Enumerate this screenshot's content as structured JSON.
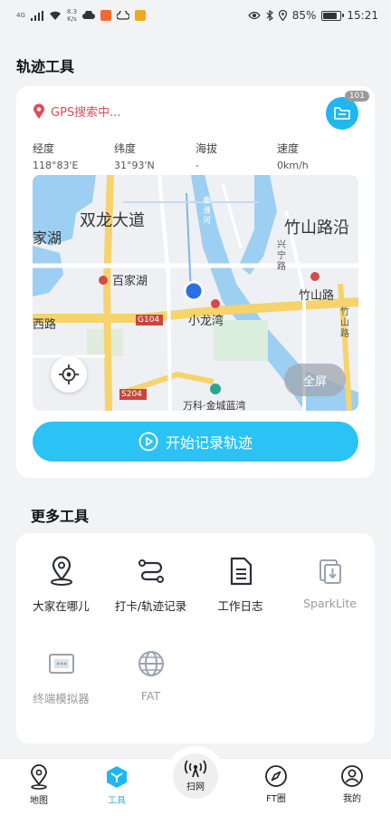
{
  "status_bar": {
    "network_type": "4G",
    "net_speed_value": "8.3",
    "net_speed_unit": "K/s",
    "battery_percent": "85%",
    "battery_level": 0.85,
    "time": "15:21"
  },
  "track_section": {
    "title": "轨迹工具",
    "gps_status": "GPS搜索中...",
    "folder_count": "101",
    "metrics": [
      {
        "label": "经度",
        "value": "118°83'E"
      },
      {
        "label": "纬度",
        "value": "31°93'N"
      },
      {
        "label": "海拔",
        "value": "-"
      },
      {
        "label": "速度",
        "value": "0km/h"
      }
    ],
    "map_labels": {
      "shuanglong": "双龙大道",
      "zhushan_yan": "竹山路沿",
      "baijiahu": "百家湖",
      "zhushan_lu": "竹山路",
      "xiaolongwan": "小龙湾",
      "xilu": "西路",
      "lake": "家湖",
      "xingning": "兴宁路",
      "zhushan_v": "竹山路",
      "qinhuai": "秦淮河",
      "g104": "G104",
      "s204": "S204",
      "bottom_poi": "万科·金城蓝湾"
    },
    "fullscreen_label": "全屏",
    "start_button_label": "开始记录轨迹"
  },
  "more_tools": {
    "title": "更多工具",
    "items": [
      {
        "label": "大家在哪儿",
        "icon": "location-pin-icon",
        "enabled": true
      },
      {
        "label": "打卡/轨迹记录",
        "icon": "route-icon",
        "enabled": true
      },
      {
        "label": "工作日志",
        "icon": "document-icon",
        "enabled": true
      },
      {
        "label": "SparkLite",
        "icon": "spark-download-icon",
        "enabled": false
      },
      {
        "label": "终端模拟器",
        "icon": "terminal-simulator-icon",
        "enabled": false
      },
      {
        "label": "FAT",
        "icon": "globe-icon",
        "enabled": false
      }
    ]
  },
  "tab_bar": {
    "tabs": [
      {
        "label": "地图",
        "icon": "map-pin-icon"
      },
      {
        "label": "工具",
        "icon": "tools-cube-icon",
        "active": true
      },
      {
        "label": "扫网",
        "icon": "signal-tower-icon"
      },
      {
        "label": "FT圈",
        "icon": "compass-icon"
      },
      {
        "label": "我的",
        "icon": "user-icon"
      }
    ]
  },
  "colors": {
    "accent": "#2bc3f5",
    "gps_warning": "#e14b5c",
    "disabled": "#9a9a9a"
  }
}
